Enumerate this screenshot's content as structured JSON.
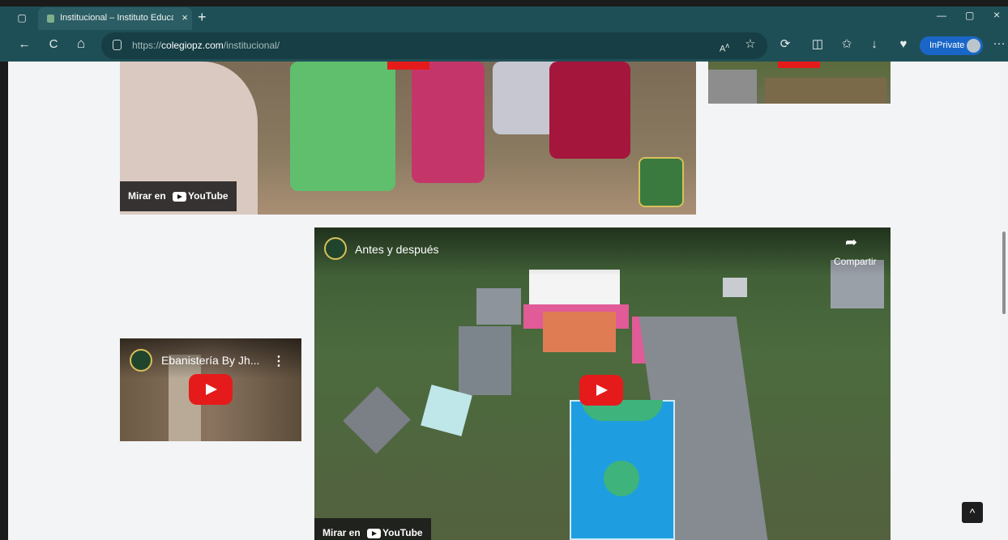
{
  "browser": {
    "tab_title": "Institucional – Instituto Educativo",
    "url_prefix": "https://",
    "url_domain": "colegiopz.com",
    "url_path": "/institucional/",
    "inprivate_label": "InPrivate"
  },
  "icons": {
    "new_tab": "+",
    "close": "×",
    "back": "←",
    "refresh": "C",
    "home": "⌂",
    "more": "···",
    "to_top": "^"
  },
  "videos": [
    {
      "watch_label": "Mirar en",
      "brand": "YouTube"
    },
    {
      "title": "Ebanistería By Jh...",
      "more": "⋮"
    },
    {
      "title": "Antes y después",
      "share_label": "Compartir",
      "watch_label": "Mirar en",
      "brand": "YouTube"
    }
  ],
  "colors": {
    "browser_chrome": "#1f4f56",
    "inprivate": "#1a66c8",
    "youtube_red": "#e51b1b",
    "page_bg": "#f3f4f6"
  }
}
